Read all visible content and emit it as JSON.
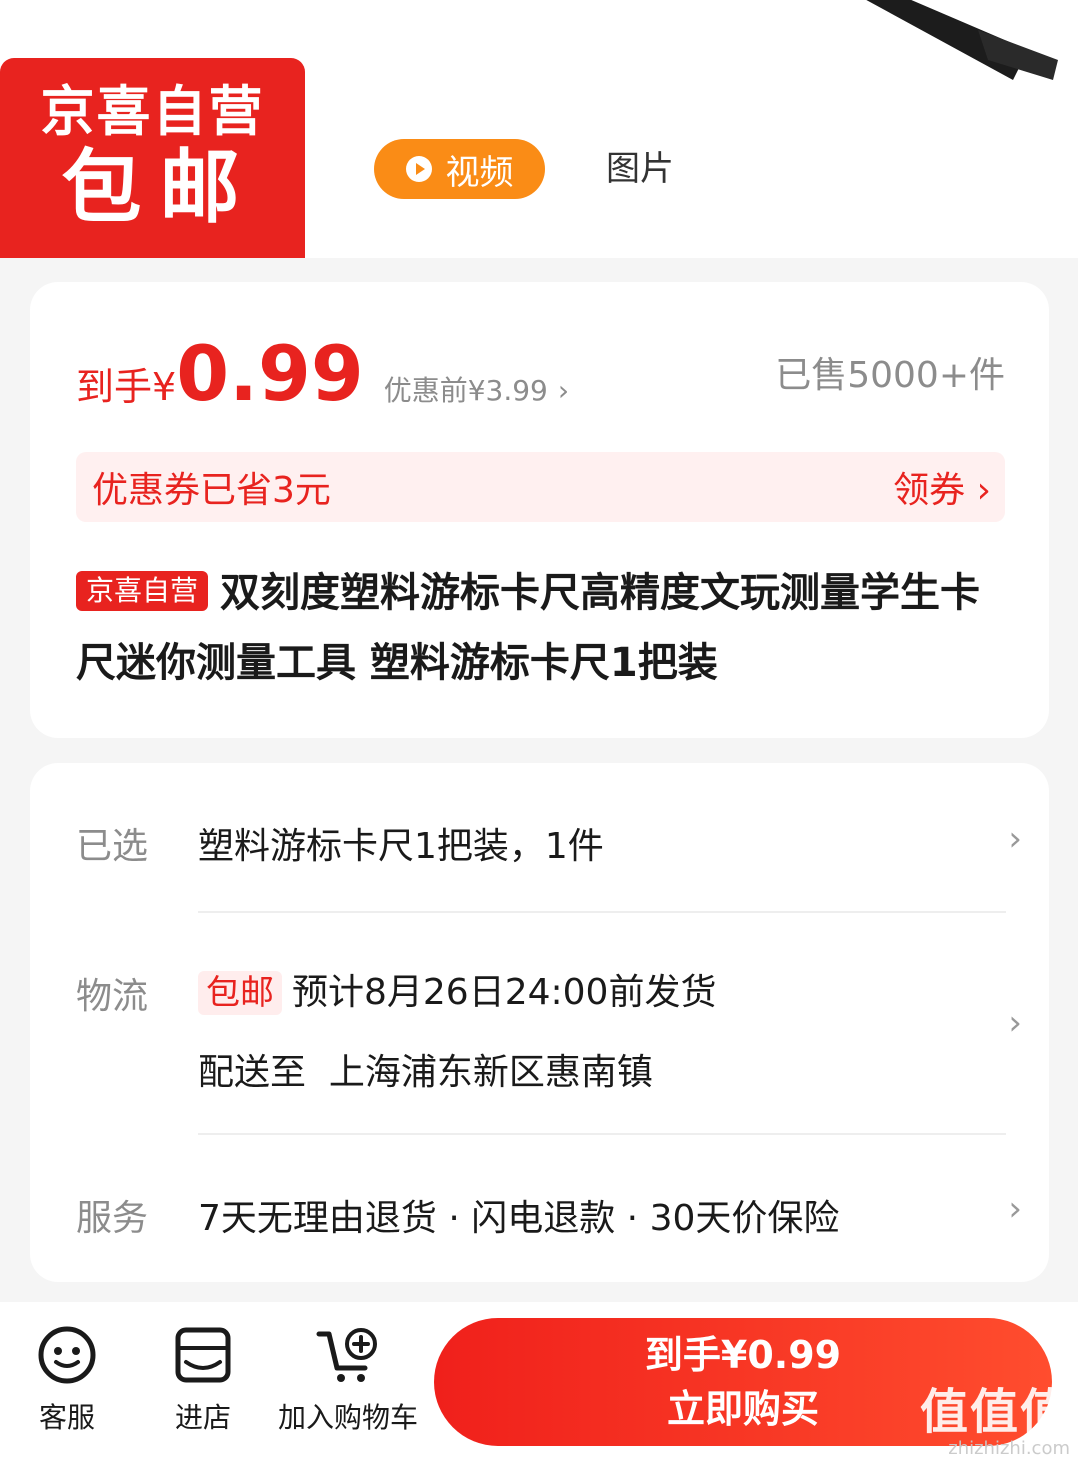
{
  "badge": {
    "line1": "京喜自营",
    "line2": "包邮"
  },
  "media_tabs": {
    "video": "视频",
    "photo": "图片"
  },
  "price": {
    "prefix": "到手¥",
    "value": "0.99",
    "before": "优惠前¥3.99",
    "sold": "已售5000+件"
  },
  "coupon": {
    "text": "优惠券已省3元",
    "action": "领券"
  },
  "product": {
    "tag": "京喜自营",
    "title": "双刻度塑料游标卡尺高精度文玩测量学生卡尺迷你测量工具 塑料游标卡尺1把装"
  },
  "info": {
    "selected": {
      "label": "已选",
      "value": "塑料游标卡尺1把装，1件"
    },
    "logistics": {
      "label": "物流",
      "tag": "包邮",
      "eta": "预计8月26日24:00前发货",
      "ship_to_label": "配送至",
      "address": "上海浦东新区惠南镇"
    },
    "service": {
      "label": "服务",
      "value": "7天无理由退货 · 闪电退款 · 30天价保险"
    }
  },
  "bottom_bar": {
    "service": "客服",
    "store": "进店",
    "cart": "加入购物车",
    "buy_price": "到手¥0.99",
    "buy_label": "立即购买"
  },
  "watermark": {
    "logo": "值值值",
    "site": "zhizhizhi.com"
  },
  "colors": {
    "accent": "#e8231f",
    "video_tab": "#fa8c16",
    "muted": "#8c8c8c"
  },
  "icons": [
    "play-icon",
    "chevron-right-icon",
    "customer-service-icon",
    "store-icon",
    "cart-add-icon"
  ]
}
